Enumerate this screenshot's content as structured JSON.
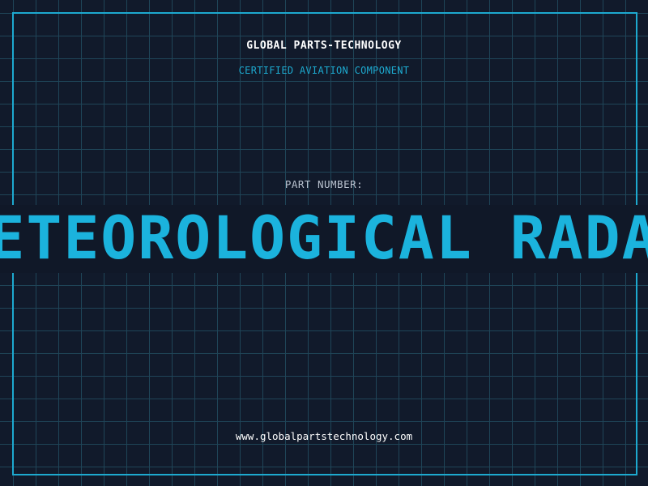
{
  "header": {
    "brand": "GLOBAL PARTS-TECHNOLOGY",
    "subtitle": "CERTIFIED AVIATION COMPONENT"
  },
  "part": {
    "label": "PART NUMBER:",
    "value": "METEOROLOGICAL RADAR"
  },
  "footer": {
    "website": "www.globalpartstechnology.com"
  },
  "colors": {
    "background": "#111a2b",
    "grid": "#1f4558",
    "accent": "#1da9cf",
    "text": "#ffffff"
  }
}
